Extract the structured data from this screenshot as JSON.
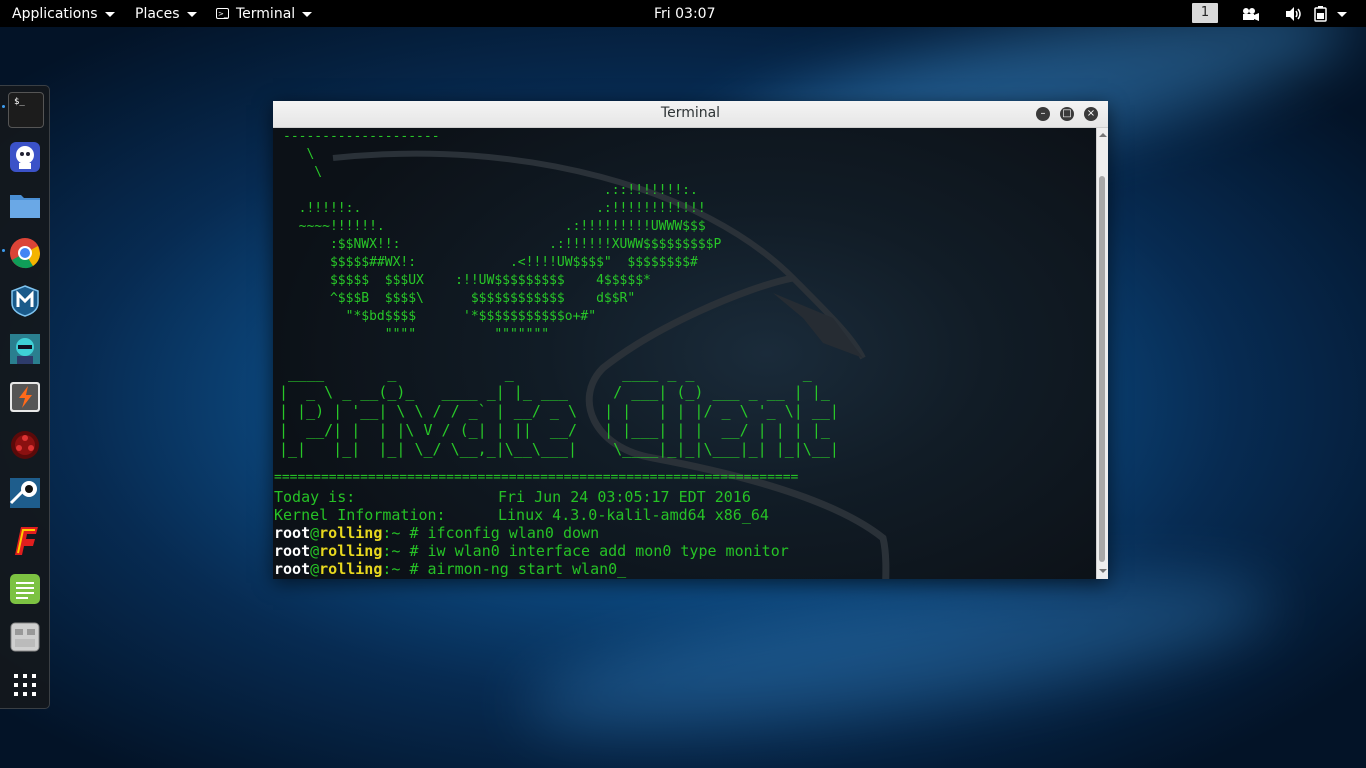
{
  "topbar": {
    "applications_label": "Applications",
    "places_label": "Places",
    "terminal_label": "Terminal",
    "clock": "Fri 03:07",
    "workspace": "1"
  },
  "dock": {
    "items": [
      {
        "icon": "terminal-icon",
        "active": true
      },
      {
        "icon": "maltego-icon"
      },
      {
        "icon": "files-icon"
      },
      {
        "icon": "chrome-icon",
        "active": true
      },
      {
        "icon": "metasploit-icon"
      },
      {
        "icon": "armitage-icon"
      },
      {
        "icon": "burpsuite-icon"
      },
      {
        "icon": "beef-icon"
      },
      {
        "icon": "faraday-icon"
      },
      {
        "icon": "ffuzz-icon"
      },
      {
        "icon": "leafpad-icon"
      },
      {
        "icon": "tweaks-icon"
      },
      {
        "icon": "show-apps-icon"
      }
    ]
  },
  "window": {
    "title": "Terminal"
  },
  "terminal": {
    "ascii_logo": "--------------------\n   \\\n    \\\n                                         .::!!!!!!!:.\n  .!!!!!:.                              .:!!!!!!!!!!!!\n  ~~~~!!!!!!.                       .:!!!!!!!!!UWWW$$$\n      :$$NWX!!:                   .:!!!!!!XUWW$$$$$$$$$P\n      $$$$$##WX!:            .<!!!!UW$$$$\"  $$$$$$$$#\n      $$$$$  $$$UX    :!!UW$$$$$$$$$    4$$$$$*\n      ^$$$B  $$$$\\      $$$$$$$$$$$$    d$$R\"\n        \"*$bd$$$$      '*$$$$$$$$$$$o+#\"\n             \"\"\"\"          \"\"\"\"\"\"\"",
    "banner": " ____       _            _            ____ _ _            _\n|  _ \\ _ __(_)_   ____ _| |_ ___     / ___| (_) ___ _ __ | |_\n| |_) | '__| \\ \\ / / _` | __/ _ \\   | |   | | |/ _ \\ '_ \\| __|\n|  __/| |  | |\\ V / (_| | ||  __/   | |___| | |  __/ | | | |_\n|_|   |_|  |_| \\_/ \\__,_|\\__\\___|    \\____|_|_|\\___|_| |_|\\__|",
    "separator": "===================================================================",
    "today_label": "Today is:",
    "today_value": "Fri Jun 24 03:05:17 EDT 2016",
    "kernel_label": "Kernel Information:",
    "kernel_value": "Linux 4.3.0-kalil-amd64 x86_64",
    "prompt_user": "root",
    "prompt_at": "@",
    "prompt_host": "rolling",
    "prompt_sep": ":~ #",
    "commands": [
      "ifconfig wlan0 down",
      "iw wlan0 interface add mon0 type monitor",
      "airmon-ng start wlan0_"
    ]
  }
}
